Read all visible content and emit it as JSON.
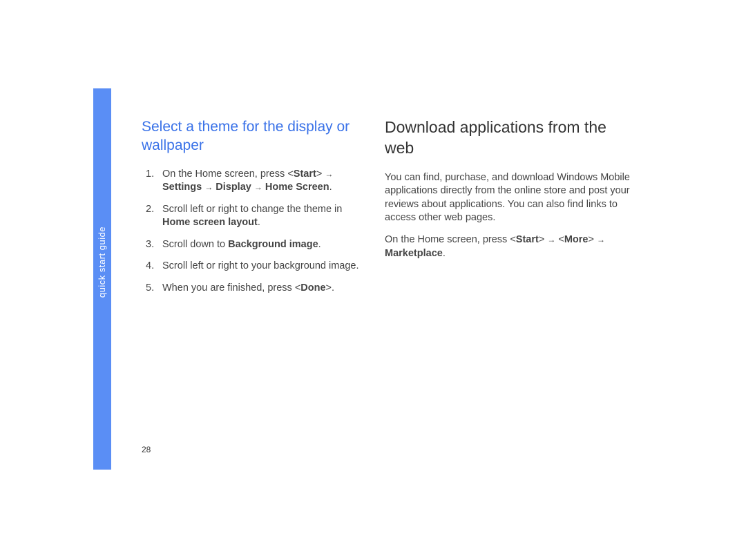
{
  "sidebar": {
    "label": "quick start guide"
  },
  "page_number": "28",
  "left": {
    "heading": "Select a theme for the display or wallpaper",
    "steps": {
      "s1": {
        "p1": "On the Home screen, press <",
        "b1": "Start",
        "p2": "> ",
        "b2": "Settings",
        "b3": "Display",
        "b4": "Home Screen",
        "p3": "."
      },
      "s2": {
        "p1": "Scroll left or right to change the theme in ",
        "b1": "Home screen layout",
        "p2": "."
      },
      "s3": {
        "p1": "Scroll down to ",
        "b1": "Background image",
        "p2": "."
      },
      "s4": {
        "p1": "Scroll left or right to your background image."
      },
      "s5": {
        "p1": "When you are finished, press <",
        "b1": "Done",
        "p2": ">."
      }
    }
  },
  "right": {
    "heading": "Download applications from the web",
    "para1": "You can find, purchase, and download Windows Mobile applications directly from the online store and post your reviews about applications. You can also find links to access other web pages.",
    "para2": {
      "p1": "On the Home screen, press <",
      "b1": "Start",
      "p2": "> ",
      "p3": "<",
      "b2": "More",
      "p4": "> ",
      "b3": "Marketplace",
      "p5": "."
    }
  },
  "arrow_glyph": "→"
}
